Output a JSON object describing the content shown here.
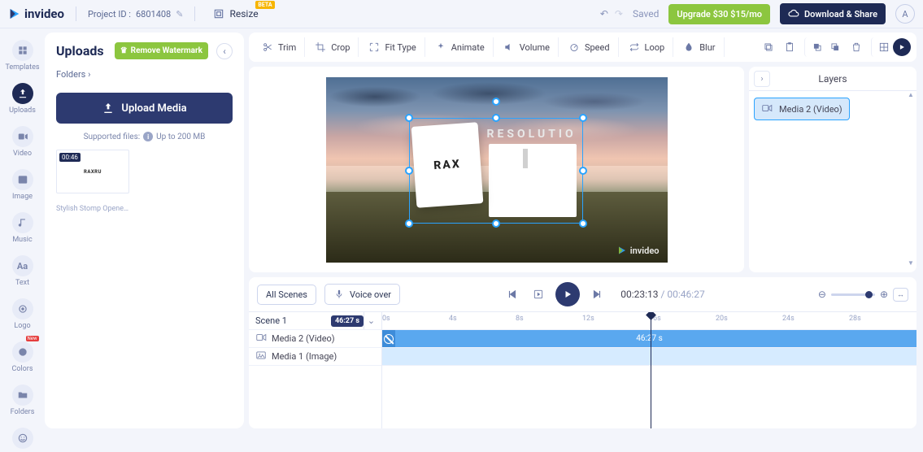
{
  "brand": "invideo",
  "project": {
    "label": "Project ID :",
    "id": "6801408"
  },
  "resize_label": "Resize",
  "beta_badge": "BETA",
  "saved_label": "Saved",
  "upgrade_label": "Upgrade $30 $15/mo",
  "share_label": "Download & Share",
  "avatar_initial": "A",
  "rail": [
    {
      "key": "templates",
      "label": "Templates"
    },
    {
      "key": "uploads",
      "label": "Uploads"
    },
    {
      "key": "video",
      "label": "Video"
    },
    {
      "key": "image",
      "label": "Image"
    },
    {
      "key": "music",
      "label": "Music"
    },
    {
      "key": "text",
      "label": "Text"
    },
    {
      "key": "logo",
      "label": "Logo"
    },
    {
      "key": "colors",
      "label": "Colors",
      "badge": "New"
    },
    {
      "key": "folders",
      "label": "Folders"
    }
  ],
  "panel": {
    "title": "Uploads",
    "watermark": "Remove Watermark",
    "folders": "Folders ›",
    "upload": "Upload Media",
    "supported_prefix": "Supported files:",
    "supported_suffix": "Up to 200 MB",
    "thumb_duration": "00:46",
    "thumb_text": "RAXRU",
    "thumb_caption": "Stylish Stomp Opener by …"
  },
  "tools": {
    "trim": "Trim",
    "crop": "Crop",
    "fit": "Fit Type",
    "animate": "Animate",
    "volume": "Volume",
    "speed": "Speed",
    "loop": "Loop",
    "blur": "Blur"
  },
  "canvas": {
    "card_text": "RAX",
    "overlay_text": "RESOLUTIO",
    "watermark_brand": "invideo"
  },
  "layers": {
    "title": "Layers",
    "items": [
      {
        "name": "Media 2 (Video)",
        "type": "video",
        "selected": true
      },
      {
        "name": "Media 1 (Image)",
        "type": "image",
        "selected": false
      }
    ]
  },
  "timeline": {
    "all_scenes": "All Scenes",
    "voice_over": "Voice over",
    "current": "00:23:13",
    "total": "00:46:27",
    "scene_label": "Scene 1",
    "scene_duration": "46:27 s",
    "ticks": [
      "0s",
      "4s",
      "8s",
      "12s",
      "16s",
      "20s",
      "24s",
      "28s"
    ],
    "tracks": [
      {
        "name": "Media 2 (Video)",
        "type": "video",
        "clip_label": "46:27 s"
      },
      {
        "name": "Media 1 (Image)",
        "type": "image"
      }
    ],
    "playhead_ratio": 0.503
  }
}
